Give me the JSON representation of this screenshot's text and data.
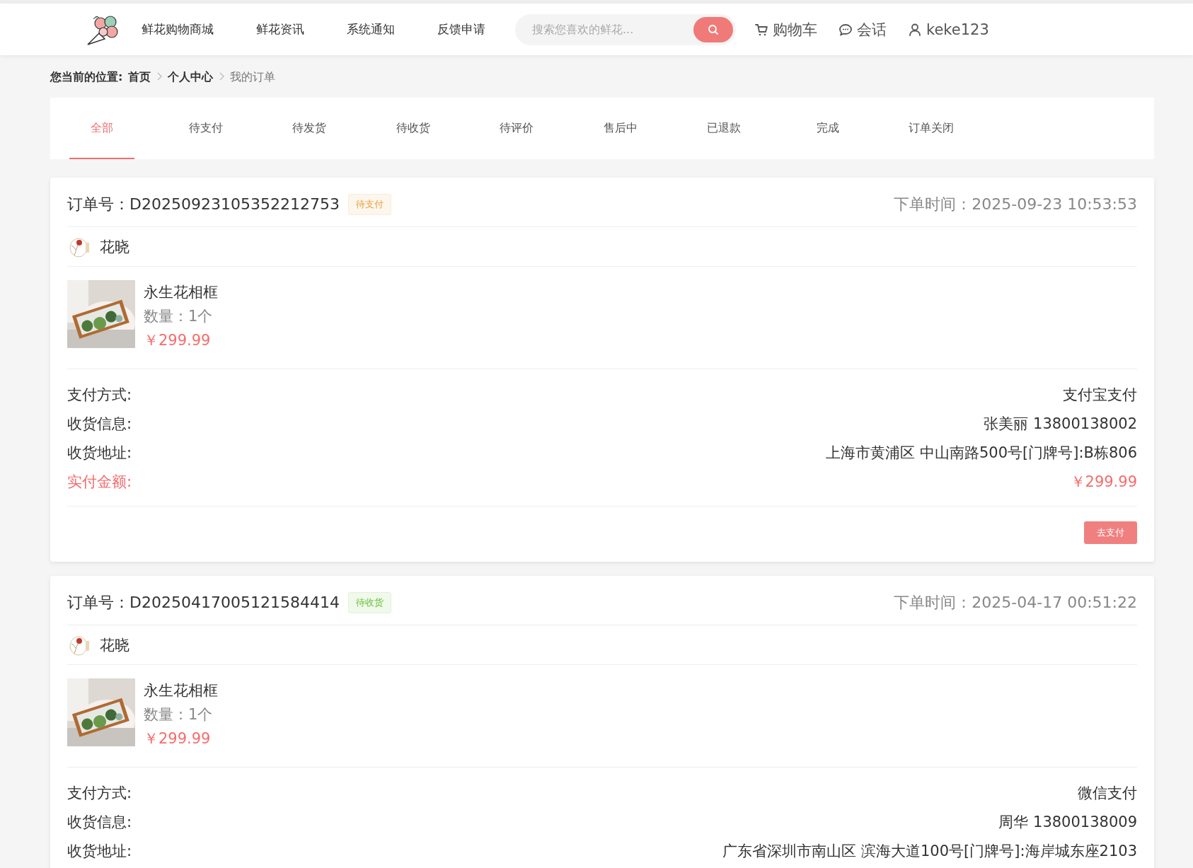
{
  "nav": {
    "links": [
      "鲜花购物商城",
      "鲜花资讯",
      "系统通知",
      "反馈申请"
    ],
    "search": {
      "placeholder": "搜索您喜欢的鲜花..."
    },
    "cart": "购物车",
    "chat": "会话",
    "user": "keke123"
  },
  "breadcrumb": {
    "label": "您当前的位置:",
    "items": [
      {
        "text": "首页",
        "current": false
      },
      {
        "text": "个人中心",
        "current": false
      },
      {
        "text": "我的订单",
        "current": true
      }
    ]
  },
  "tabs": [
    {
      "label": "全部",
      "selected": true
    },
    {
      "label": "待支付",
      "selected": false
    },
    {
      "label": "待发货",
      "selected": false
    },
    {
      "label": "待收货",
      "selected": false
    },
    {
      "label": "待评价",
      "selected": false
    },
    {
      "label": "售后中",
      "selected": false
    },
    {
      "label": "已退款",
      "selected": false
    },
    {
      "label": "完成",
      "selected": false
    },
    {
      "label": "订单关闭",
      "selected": false
    }
  ],
  "orders": [
    {
      "number": "订单号：D20250923105352212753",
      "status": {
        "label": "待支付",
        "kind": "pending_payment"
      },
      "time": "下单时间：2025-09-23 10:53:53",
      "shop": "花晓",
      "product": {
        "name": "永生花相框",
        "quantity": "数量：1个",
        "price": "￥299.99"
      },
      "info": [
        {
          "label": "支付方式:",
          "value": "支付宝支付",
          "kind": "normal"
        },
        {
          "label": "收货信息:",
          "value": "张美丽 13800138002",
          "kind": "normal"
        },
        {
          "label": "收货地址:",
          "value": "上海市黄浦区 中山南路500号[门牌号]:B栋806",
          "kind": "normal"
        },
        {
          "label": "实付金额:",
          "value": "￥299.99",
          "kind": "total"
        }
      ],
      "actions": [
        "去支付"
      ]
    },
    {
      "number": "订单号：D20250417005121584414",
      "status": {
        "label": "待收货",
        "kind": "pending_receipt"
      },
      "time": "下单时间：2025-04-17 00:51:22",
      "shop": "花晓",
      "product": {
        "name": "永生花相框",
        "quantity": "数量：1个",
        "price": "￥299.99"
      },
      "info": [
        {
          "label": "支付方式:",
          "value": "微信支付",
          "kind": "normal"
        },
        {
          "label": "收货信息:",
          "value": "周华 13800138009",
          "kind": "normal"
        },
        {
          "label": "收货地址:",
          "value": "广东省深圳市南山区 滨海大道100号[门牌号]:海岸城东座2103",
          "kind": "normal"
        }
      ]
    }
  ]
}
